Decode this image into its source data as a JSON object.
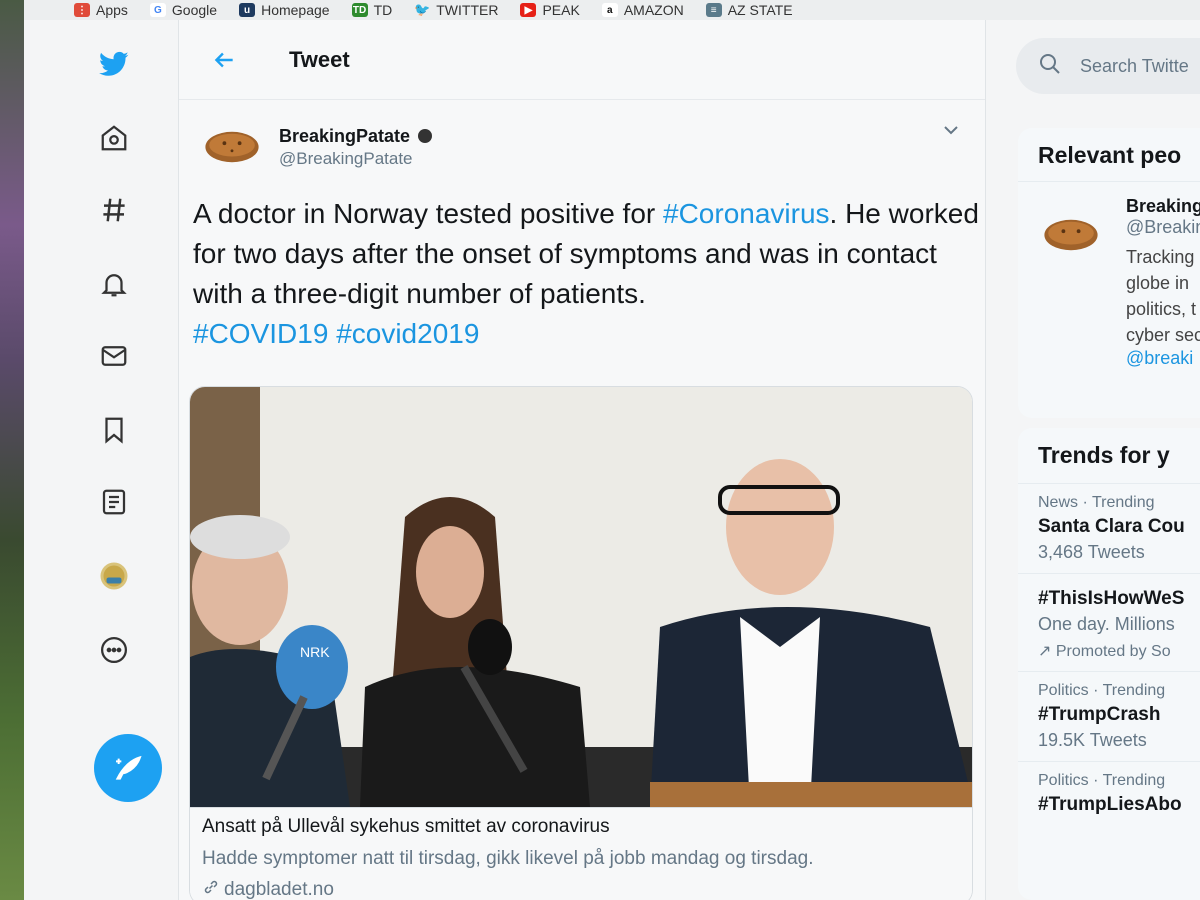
{
  "bookmarks": [
    {
      "label": "Apps",
      "icon": "apps-grid-icon",
      "color": "#e04b3a"
    },
    {
      "label": "Google",
      "icon": "google-icon",
      "color": "#4285f4"
    },
    {
      "label": "Homepage",
      "icon": "homepage-icon",
      "color": "#1e3a5f"
    },
    {
      "label": "TD",
      "icon": "td-bank-icon",
      "color": "#2e8b2e"
    },
    {
      "label": "TWITTER",
      "icon": "twitter-bird-icon",
      "color": "#1da1f2"
    },
    {
      "label": "PEAK",
      "icon": "youtube-icon",
      "color": "#e62117"
    },
    {
      "label": "AMAZON",
      "icon": "amazon-icon",
      "color": "#111111"
    },
    {
      "label": "AZ STATE",
      "icon": "az-state-icon",
      "color": "#5a7a8a"
    }
  ],
  "header": {
    "title": "Tweet"
  },
  "tweet": {
    "author_name": "BreakingPatate",
    "author_handle": "@BreakingPatate",
    "text_part1": "A doctor in Norway tested positive for ",
    "hashtag1": "#Coronavirus",
    "text_part2": ". He worked for two days after the onset of symptoms and was in contact with a three-digit number of patients. ",
    "hashtag2": "#COVID19",
    "hashtag3": "#covid2019"
  },
  "card": {
    "title": "Ansatt på Ullevål sykehus smittet av coronavirus",
    "description": "Hadde symptomer natt til tirsdag, gikk likevel på jobb mandag og tirsdag.",
    "domain": "dagbladet.no",
    "mic_label": "NRK"
  },
  "sidebar": {
    "search_placeholder": "Search Twitte",
    "relevant_title": "Relevant peo",
    "person": {
      "name": "Breaking",
      "handle": "@Breakin",
      "bio": [
        "Tracking",
        "globe in",
        "politics, t",
        "cyber sec"
      ],
      "link": "@breaki"
    },
    "trends_title": "Trends for y",
    "trends": [
      {
        "meta": "News · Trending",
        "name": "Santa Clara Cou",
        "count": "3,468 Tweets"
      },
      {
        "meta": "",
        "name": "#ThisIsHowWeS",
        "count": "One day. Millions",
        "promo": "Promoted by So"
      },
      {
        "meta": "Politics · Trending",
        "name": "#TrumpCrash",
        "count": "19.5K Tweets"
      },
      {
        "meta": "Politics · Trending",
        "name": "#TrumpLiesAbo",
        "count": ""
      }
    ]
  },
  "colors": {
    "accent": "#1da1f2",
    "link": "#1b95e0"
  }
}
